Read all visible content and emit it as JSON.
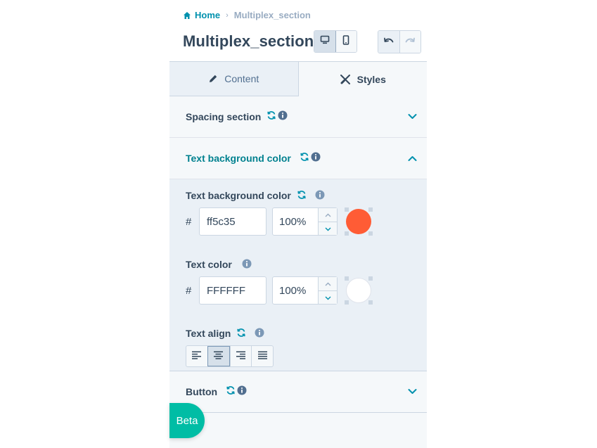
{
  "breadcrumb": {
    "home": "Home",
    "separator": "›",
    "current": "Multiplex_section"
  },
  "page_title": "Multiplex_section",
  "tabs": [
    {
      "label": "Content",
      "icon": "pencil-icon",
      "active": false
    },
    {
      "label": "Styles",
      "icon": "paint-tools-icon",
      "active": true
    }
  ],
  "sections": {
    "spacing": {
      "title": "Spacing section",
      "expanded": false
    },
    "text_bg": {
      "title": "Text background color",
      "expanded": true,
      "fields": {
        "bg_color": {
          "label": "Text background color",
          "hash": "#",
          "hex": "ff5c35",
          "opacity": "100%",
          "swatch": "#ff5c35"
        },
        "text_color": {
          "label": "Text color",
          "hash": "#",
          "hex": "FFFFFF",
          "opacity": "100%",
          "swatch": "#ffffff"
        },
        "text_align": {
          "label": "Text align",
          "options": [
            "left",
            "center",
            "right",
            "justify"
          ],
          "selected": "center"
        }
      }
    },
    "button": {
      "title": "Button",
      "expanded": false
    }
  },
  "beta_badge": "Beta",
  "colors": {
    "accent": "#0091ae",
    "teal_title": "#00818f",
    "beta": "#00bda5",
    "text": "#33475b"
  }
}
